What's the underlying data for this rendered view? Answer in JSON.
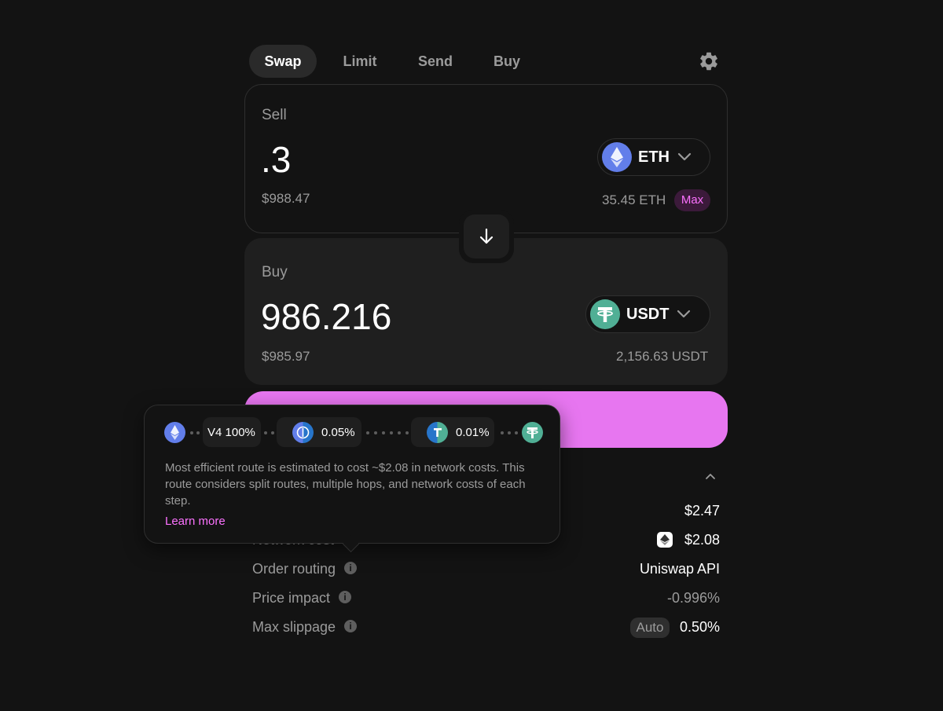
{
  "tabs": [
    {
      "label": "Swap",
      "active": true
    },
    {
      "label": "Limit",
      "active": false
    },
    {
      "label": "Send",
      "active": false
    },
    {
      "label": "Buy",
      "active": false
    }
  ],
  "sell": {
    "label": "Sell",
    "amount": ".3",
    "usd_value": "$988.47",
    "token": {
      "symbol": "ETH",
      "icon": "eth-icon"
    },
    "balance": "35.45 ETH",
    "max_label": "Max"
  },
  "buy": {
    "label": "Buy",
    "amount": "986.216",
    "usd_value": "$985.97",
    "token": {
      "symbol": "USDT",
      "icon": "usdt-icon"
    },
    "balance": "2,156.63 USDT"
  },
  "route_tooltip": {
    "chips": [
      {
        "label": "V4 100%"
      },
      {
        "label": "0.05%"
      },
      {
        "label": "0.01%"
      }
    ],
    "description": "Most efficient route is estimated to cost ~$2.08 in network costs. This route considers split routes, multiple hops, and network costs of each step.",
    "learn_more": "Learn more"
  },
  "details": {
    "fee_value": "$2.47",
    "network_cost_label": "Network cost",
    "network_cost_value": "$2.08",
    "order_routing_label": "Order routing",
    "order_routing_value": "Uniswap API",
    "price_impact_label": "Price impact",
    "price_impact_value": "-0.996%",
    "max_slippage_label": "Max slippage",
    "slippage_mode": "Auto",
    "slippage_value": "0.50%"
  },
  "colors": {
    "background": "#131313",
    "accent": "#fc72ff",
    "button": "#e776f0",
    "eth": "#627eea",
    "usdt": "#50af95",
    "usdc": "#2775ca"
  }
}
